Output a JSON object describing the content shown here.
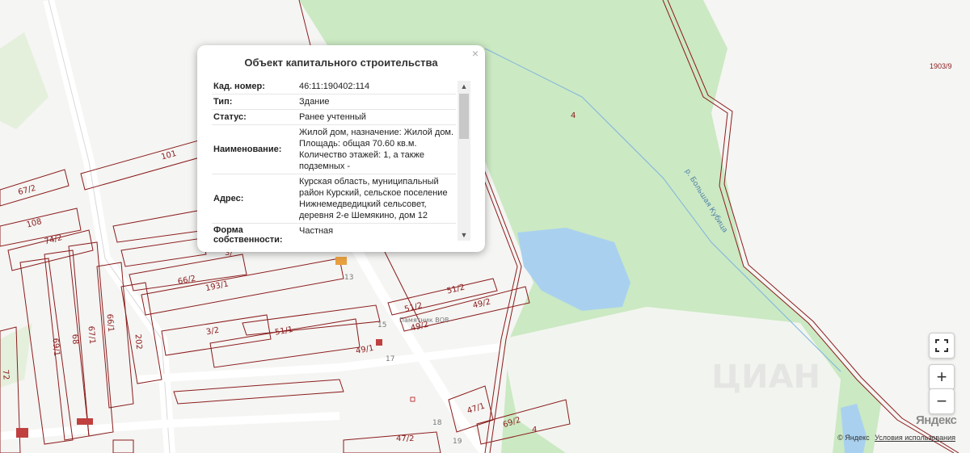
{
  "popup": {
    "title": "Объект капитального строительства",
    "close": "×",
    "rows": [
      {
        "key": "Кад. номер:",
        "value": "46:11:190402:114"
      },
      {
        "key": "Тип:",
        "value": "Здание"
      },
      {
        "key": "Статус:",
        "value": "Ранее учтенный"
      },
      {
        "key": "Наименование:",
        "value": "Жилой дом, назначение: Жилой дом. Площадь: общая 70.60 кв.м. Количество этажей: 1, а также подземных -"
      },
      {
        "key": "Адрес:",
        "value": "Курская область, муниципальный район Курский, сельское поселение Нижнемедведицкий сельсовет, деревня 2-е Шемякино, дом 12"
      },
      {
        "key": "Форма собственности:",
        "value": "Частная"
      }
    ]
  },
  "map": {
    "plot_labels": [
      "101",
      "67/2",
      "108",
      "74/2",
      "66/2",
      "193/1",
      "3/2",
      "51/1",
      "49/1",
      "51/2",
      "51/2",
      "49/2",
      "49/2",
      "47/1",
      "69/2",
      "4",
      "47/2",
      "69/1",
      "68",
      "67/1",
      "66/1",
      "202",
      "4",
      "3/",
      "72"
    ],
    "house_numbers": [
      "13",
      "15",
      "17",
      "19",
      "18"
    ],
    "river": "р. Большая Кубица",
    "memorial": "Памятник ВОВ",
    "top_right_label": "1903/9",
    "watermark": "ЦИАН"
  },
  "controls": {
    "fullscreen_icon": "fullscreen-icon",
    "zoom_in": "+",
    "zoom_out": "−"
  },
  "footer": {
    "copyright": "© Яндекс",
    "terms": "Условия использования",
    "logo": "Яндекс"
  },
  "colors": {
    "forest": "#c8e8c0",
    "water": "#a8d0ee",
    "plot_border": "#8a1c1c",
    "road": "#ffffff"
  }
}
